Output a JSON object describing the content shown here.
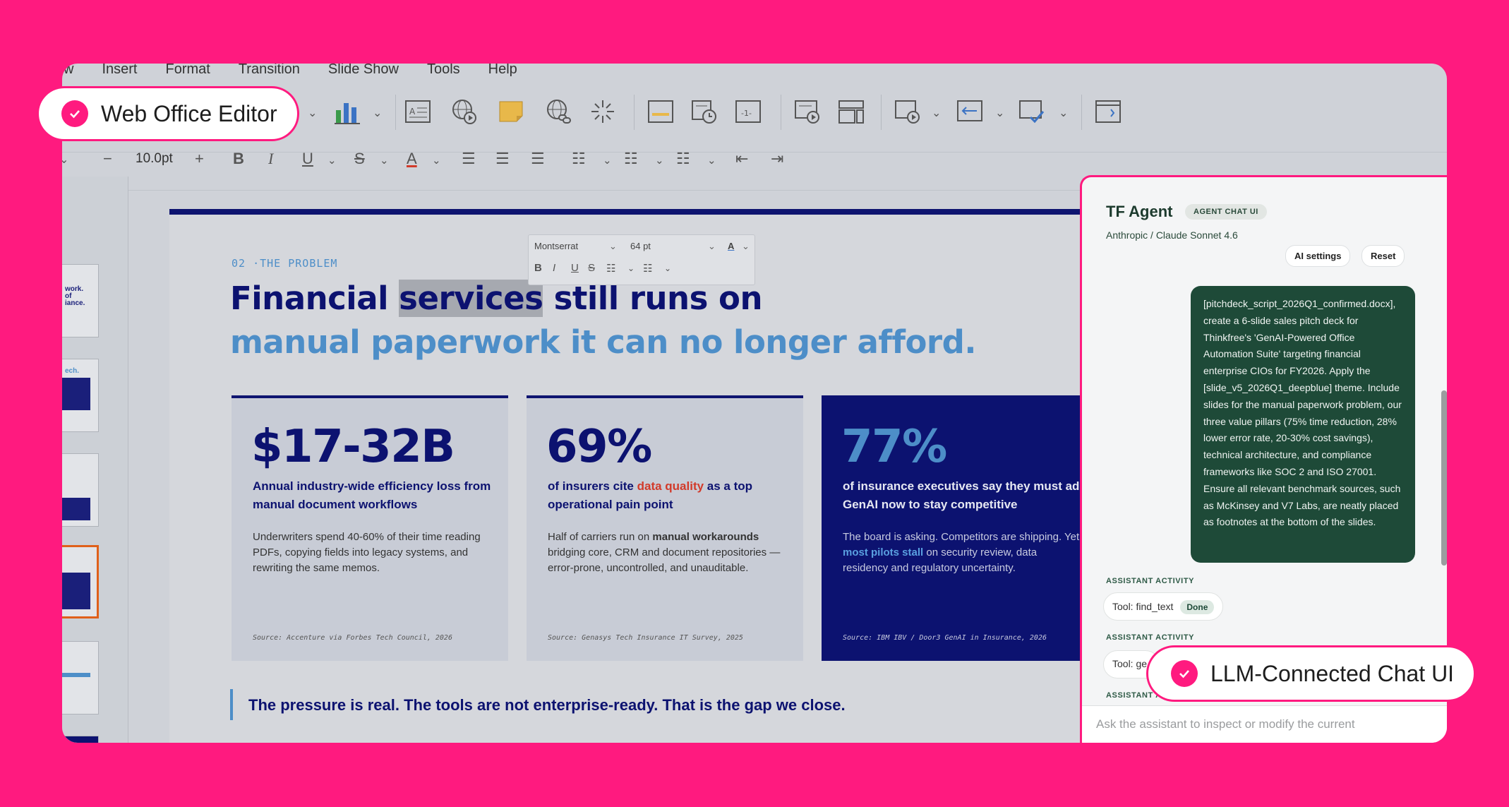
{
  "menu": [
    "w",
    "Insert",
    "Format",
    "Transition",
    "Slide Show",
    "Tools",
    "Help"
  ],
  "toolbar": {
    "font_size": "10.0pt",
    "minus": "−",
    "plus": "+"
  },
  "floating_format": {
    "font": "Montserrat",
    "size": "64 pt"
  },
  "slide": {
    "eyebrow": "02 ·THE PROBLEM",
    "title_pre": "Financial ",
    "title_highlight": "services",
    "title_post": " still runs on",
    "title_line2": "manual paperwork it can no longer afford.",
    "cards": [
      {
        "stat": "$17-32B",
        "lead": "Annual industry-wide efficiency loss from manual document workflows",
        "body": "Underwriters spend 40-60% of their time reading PDFs, copying fields into legacy systems, and rewriting the same memos.",
        "source": "Source: Accenture via Forbes Tech Council, 2026"
      },
      {
        "stat": "69%",
        "lead_pre": "of insurers cite ",
        "lead_red": "data quality",
        "lead_post": " as a top operational pain point",
        "body_pre": "Half of carriers run on ",
        "body_bold": "manual workarounds",
        "body_post": " bridging core, CRM and document repositories — error-prone, uncontrolled, and unauditable.",
        "source": "Source: Genasys Tech Insurance IT Survey, 2025"
      },
      {
        "stat": "77%",
        "lead": "of insurance executives say they must adopt GenAI now to stay competitive",
        "body_pre": "The board is asking. Competitors are shipping. Yet ",
        "body_link": "most pilots stall",
        "body_post": " on security review, data residency and regulatory uncertainty.",
        "source": "Source: IBM IBV / Door3 GenAI in Insurance, 2026"
      }
    ],
    "quote": "The pressure is real. The tools are not enterprise-ready. That is the gap we close."
  },
  "agent": {
    "title": "TF Agent",
    "badge": "AGENT CHAT UI",
    "model": "Anthropic / Claude Sonnet 4.6",
    "ai_settings": "AI settings",
    "reset": "Reset",
    "message": "[pitchdeck_script_2026Q1_confirmed.docx], create a 6-slide sales pitch deck for Thinkfree's 'GenAI-Powered Office Automation Suite' targeting financial enterprise CIOs for FY2026. Apply the [slide_v5_2026Q1_deepblue] theme. Include slides for the manual paperwork problem, our three value pillars (75% time reduction, 28% lower error rate, 20-30% cost savings), technical architecture, and compliance frameworks like SOC 2 and ISO 27001. Ensure all relevant benchmark sources, such as McKinsey and V7 Labs, are neatly placed as footnotes at the bottom of the slides.",
    "activity_label": "ASSISTANT ACTIVITY",
    "activity_label_cut": "ASSISTANT A",
    "tool1": "Tool: find_text",
    "tool1_status": "Done",
    "tool2": "Tool: ge",
    "input_placeholder": "Ask the assistant to inspect or modify the current"
  },
  "callouts": {
    "editor": "Web Office Editor",
    "chat": "LLM-Connected Chat UI"
  },
  "colors": {
    "background": "#FF1A7F",
    "navy": "#0C1270",
    "accent_blue": "#4D8EC8",
    "agent_green": "#1E4A38"
  }
}
